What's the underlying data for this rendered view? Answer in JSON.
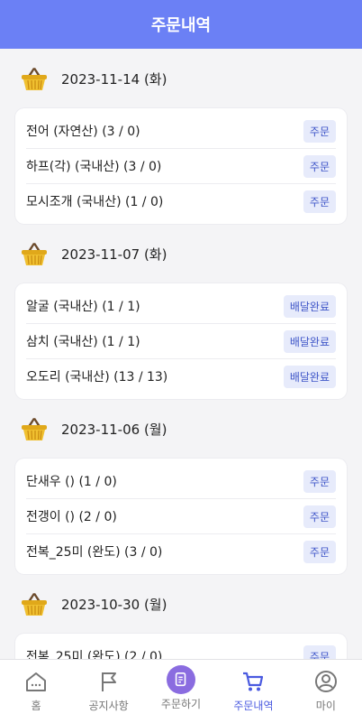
{
  "header": {
    "title": "주문내역"
  },
  "groups": [
    {
      "date": "2023-11-14 (화)",
      "items": [
        {
          "name": "전어 (자연산) (3 / 0)",
          "status": "주문"
        },
        {
          "name": "하프(각) (국내산) (3 / 0)",
          "status": "주문"
        },
        {
          "name": "모시조개 (국내산) (1 / 0)",
          "status": "주문"
        }
      ]
    },
    {
      "date": "2023-11-07 (화)",
      "items": [
        {
          "name": "알굴 (국내산) (1 / 1)",
          "status": "배달완료"
        },
        {
          "name": "삼치 (국내산) (1 / 1)",
          "status": "배달완료"
        },
        {
          "name": "오도리 (국내산) (13 / 13)",
          "status": "배달완료"
        }
      ]
    },
    {
      "date": "2023-11-06 (월)",
      "items": [
        {
          "name": "단새우 () (1 / 0)",
          "status": "주문"
        },
        {
          "name": "전갱이 () (2 / 0)",
          "status": "주문"
        },
        {
          "name": "전복_25미 (완도) (3 / 0)",
          "status": "주문"
        }
      ]
    },
    {
      "date": "2023-10-30 (월)",
      "items": [
        {
          "name": "전복_25미 (완도) (2 / 0)",
          "status": "주문"
        }
      ]
    }
  ],
  "tabbar": {
    "tabs": [
      {
        "label": "홈",
        "icon": "home-icon"
      },
      {
        "label": "공지사항",
        "icon": "flag-icon"
      },
      {
        "label": "주문하기",
        "icon": "order-form-icon"
      },
      {
        "label": "주문내역",
        "icon": "cart-icon"
      },
      {
        "label": "마이",
        "icon": "user-icon"
      }
    ],
    "active": "주문내역"
  },
  "colors": {
    "header": "#6b80f5",
    "accent": "#4a5ae0",
    "badge_bg": "#e7ebfb"
  }
}
